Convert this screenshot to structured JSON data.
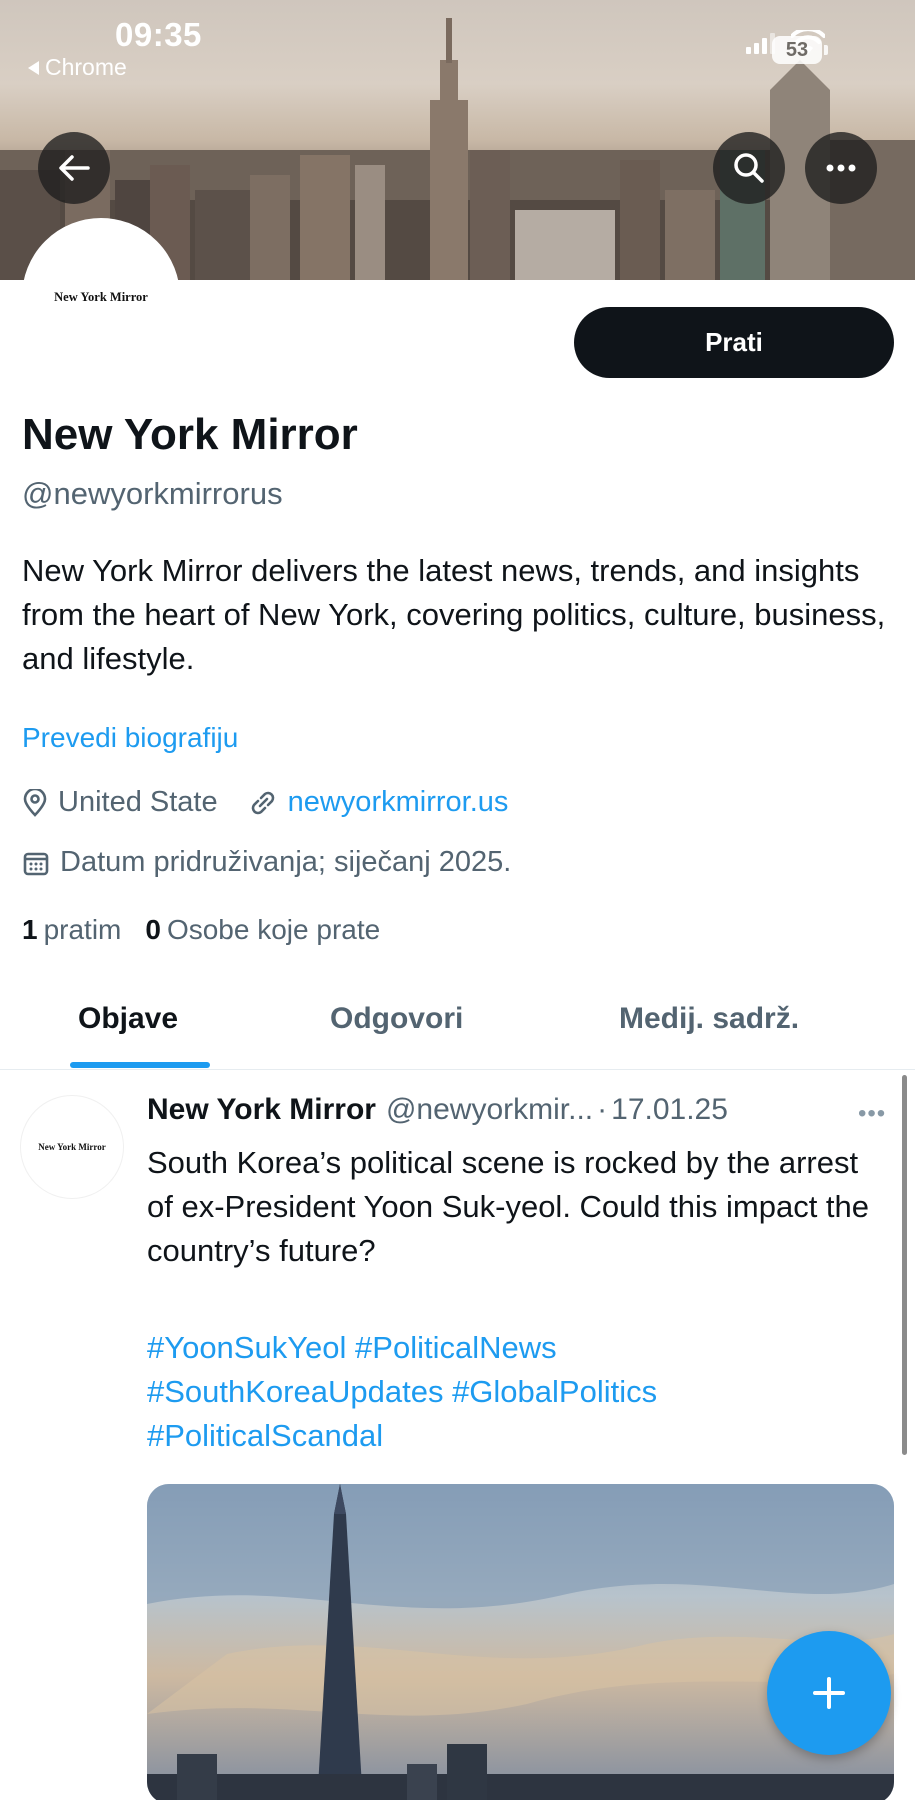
{
  "status_bar": {
    "time": "09:35",
    "back_app": "Chrome",
    "battery": "53"
  },
  "header": {
    "back_icon": "arrow-left-icon",
    "search_icon": "search-icon",
    "more_icon": "more-horizontal-icon"
  },
  "profile": {
    "avatar_text": "New York Mirror",
    "follow_label": "Prati",
    "display_name": "New York Mirror",
    "handle": "@newyorkmirrorus",
    "bio": "New York Mirror delivers the latest news, trends, and insights from the heart of New York, covering politics, culture, business, and lifestyle.",
    "translate_label": "Prevedi biografiju",
    "location": "United State",
    "website": "newyorkmirror.us",
    "joined": "Datum pridruživanja; siječanj 2025.",
    "following_count": "1",
    "following_label": "pratim",
    "followers_count": "0",
    "followers_label": "Osobe koje prate"
  },
  "tabs": [
    {
      "label": "Objave",
      "active": true
    },
    {
      "label": "Odgovori",
      "active": false
    },
    {
      "label": "Medij. sadrž.",
      "active": false
    }
  ],
  "post": {
    "avatar_text": "New York Mirror",
    "author": "New York Mirror",
    "handle": "@newyorkmir...",
    "separator": "·",
    "date": "17.01.25",
    "text": "South Korea’s political scene is rocked by the arrest of ex-President Yoon Suk-yeol. Could this impact the country’s future?",
    "hashtags": [
      "#YoonSukYeol",
      "#PoliticalNews",
      "#SouthKoreaUpdates",
      "#GlobalPolitics",
      "#PoliticalScandal"
    ]
  },
  "colors": {
    "accent": "#1d9bf0",
    "text_primary": "#0f1419",
    "text_secondary": "#536471",
    "button_dark": "#0f1419"
  }
}
